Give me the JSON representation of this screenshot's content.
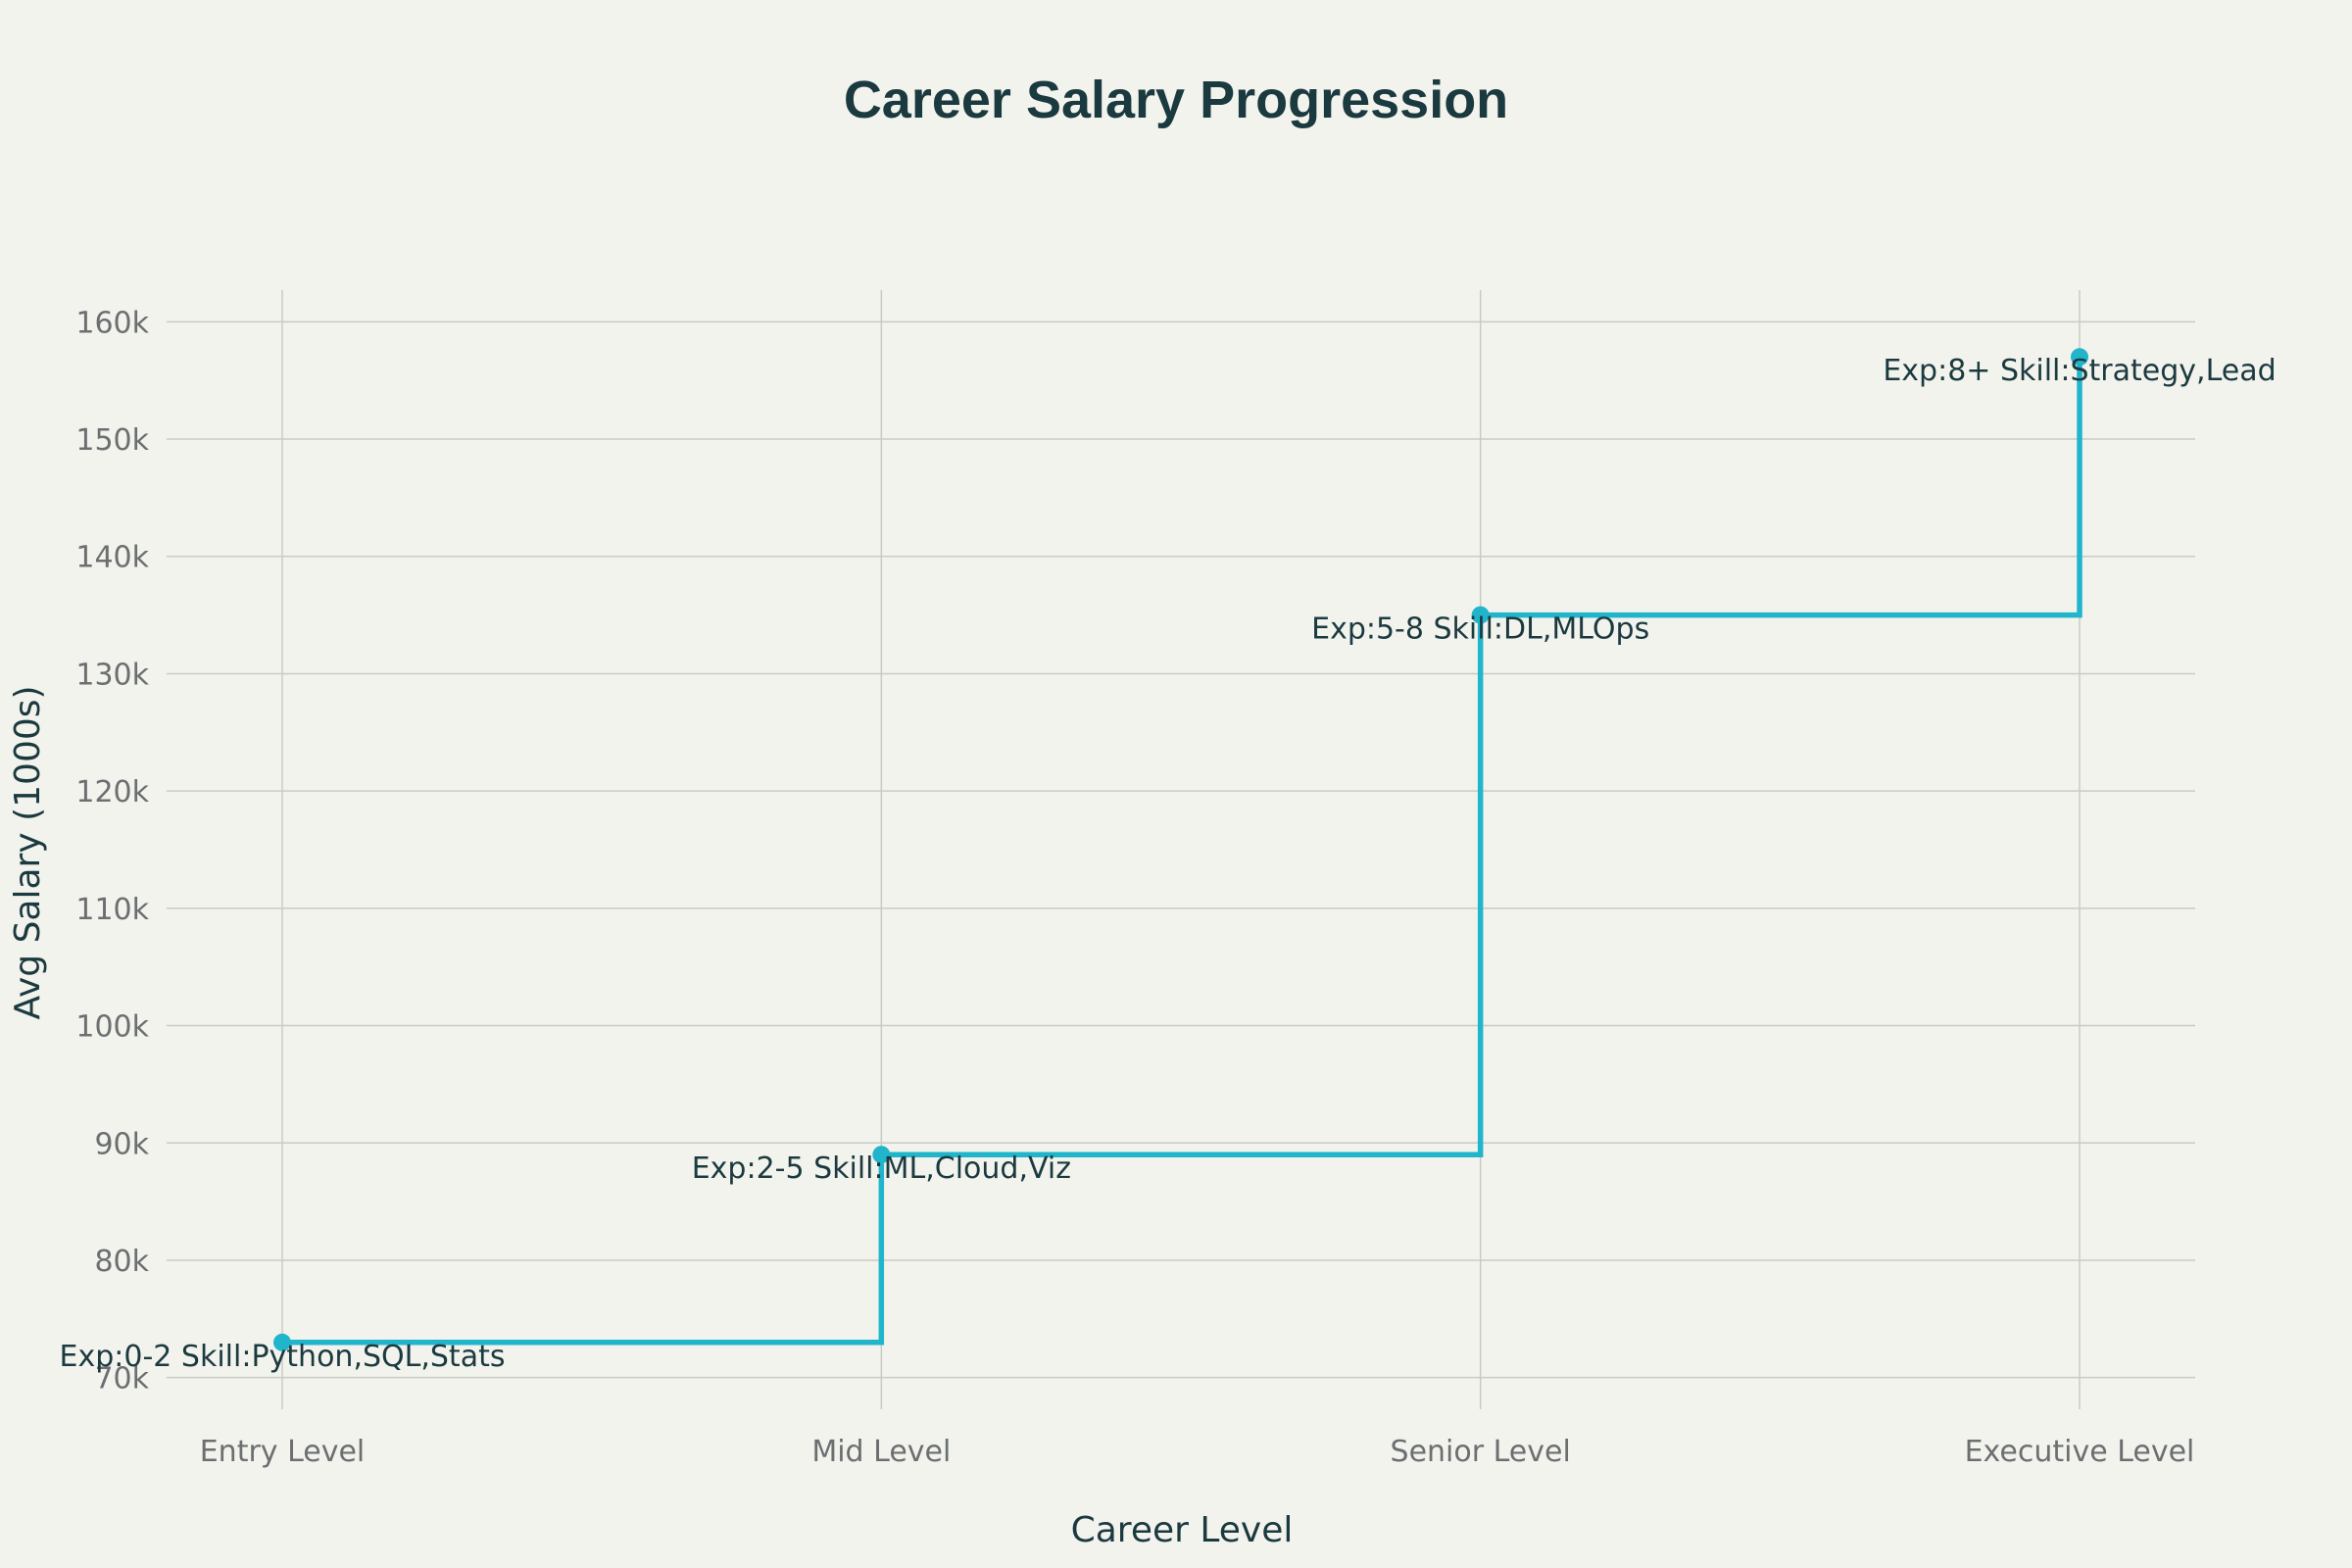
{
  "chart_data": {
    "type": "line",
    "title": "Career Salary Progression",
    "xlabel": "Career Level",
    "ylabel": "Avg Salary (1000s)",
    "categories": [
      "Entry Level",
      "Mid Level",
      "Senior Level",
      "Executive Level"
    ],
    "series": [
      {
        "values": [
          73,
          89,
          135,
          157
        ],
        "labels": [
          "Exp:0-2 Skill:Python,SQL,Stats",
          "Exp:2-5 Skill:ML,Cloud,Viz",
          "Exp:5-8 Skill:DL,MLOps",
          "Exp:8+ Skill:Strategy,Lead"
        ]
      }
    ],
    "line_shape": "step-after",
    "ylim": [
      67.3,
      162.7
    ],
    "yticks": [
      70,
      80,
      90,
      100,
      110,
      120,
      130,
      140,
      150,
      160
    ],
    "ytick_labels": [
      "70k",
      "80k",
      "90k",
      "100k",
      "110k",
      "120k",
      "130k",
      "140k",
      "150k",
      "160k"
    ],
    "grid": true,
    "legend": "none",
    "colors": {
      "line": "#21b5cc",
      "background": "#f3f3ee",
      "grid": "#c9cac6",
      "title": "#1b3a3f"
    }
  }
}
